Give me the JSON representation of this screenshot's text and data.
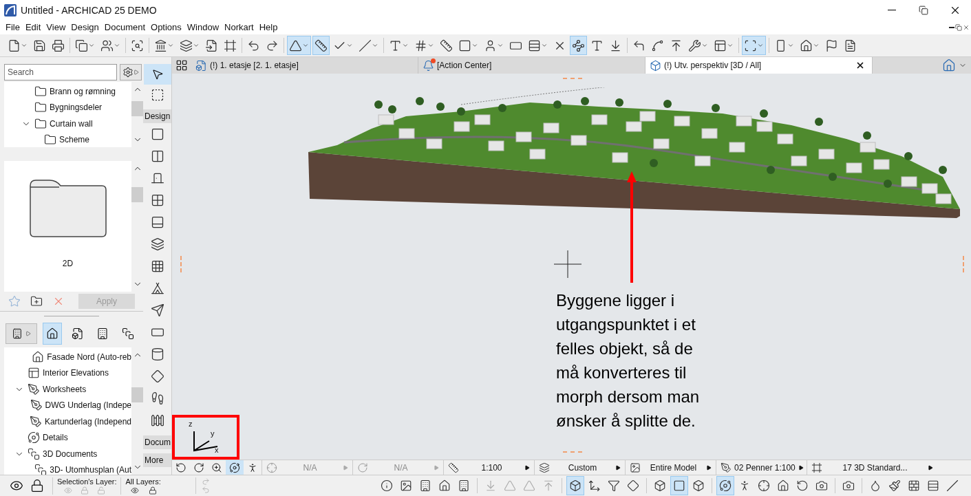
{
  "window": {
    "title": "Untitled - ARCHICAD 25 DEMO"
  },
  "menu": [
    "File",
    "Edit",
    "View",
    "Design",
    "Document",
    "Options",
    "Window",
    "Norkart",
    "Help"
  ],
  "toolbar": {
    "buttons": [
      {
        "pressed": false
      },
      {
        "pressed": false
      },
      {
        "pressed": false
      },
      {
        "pressed": false
      },
      {
        "pressed": false
      },
      {
        "pressed": false
      },
      {
        "pressed": false
      },
      {
        "pressed": false
      },
      {
        "pressed": false
      },
      {
        "pressed": false
      },
      {
        "pressed": false
      },
      {
        "pressed": false
      },
      {
        "pressed": true
      },
      {
        "pressed": true
      },
      {
        "pressed": false
      },
      {
        "pressed": false
      },
      {
        "pressed": false
      },
      {
        "pressed": false
      },
      {
        "pressed": false
      },
      {
        "pressed": false
      },
      {
        "pressed": false
      },
      {
        "pressed": false
      },
      {
        "pressed": false
      },
      {
        "pressed": false
      },
      {
        "pressed": true
      },
      {
        "pressed": false
      },
      {
        "pressed": false
      },
      {
        "pressed": false
      },
      {
        "pressed": false
      },
      {
        "pressed": false
      },
      {
        "pressed": false
      },
      {
        "pressed": false
      },
      {
        "pressed": true
      },
      {
        "pressed": false
      },
      {
        "pressed": false
      },
      {
        "pressed": false
      },
      {
        "pressed": false
      }
    ]
  },
  "navigator": {
    "search": {
      "placeholder": "Search"
    },
    "items": [
      {
        "label": "Brann og rømning",
        "kind": "folder"
      },
      {
        "label": "Bygningsdeler",
        "kind": "folder"
      },
      {
        "label": "Curtain wall",
        "kind": "folder",
        "expanded": true,
        "children": [
          {
            "label": "Scheme",
            "kind": "folder"
          }
        ]
      }
    ],
    "preview": {
      "label": "2D"
    },
    "apply_button": {
      "label": "Apply",
      "disabled": true
    },
    "map_views": [
      {
        "selected": true
      },
      {
        "selected": false
      },
      {
        "selected": false
      },
      {
        "selected": false
      }
    ],
    "tree": [
      {
        "kind": "group",
        "children": [
          {
            "label": "Fasade Nord (Auto-reb",
            "kind": "elevation"
          }
        ]
      },
      {
        "label": "Interior Elevations",
        "kind": "interior-elevation"
      },
      {
        "label": "Worksheets",
        "kind": "worksheet",
        "expanded": true,
        "children": [
          {
            "label": "DWG Underlag (Indepe",
            "kind": "worksheet"
          },
          {
            "label": "Kartunderlag (Independ",
            "kind": "worksheet"
          }
        ]
      },
      {
        "label": "Details",
        "kind": "detail"
      },
      {
        "label": "3D Documents",
        "kind": "document-3d",
        "expanded": true,
        "children": [
          {
            "label": "3D- Utomhusplan (Aut",
            "kind": "document-3d"
          }
        ]
      }
    ]
  },
  "toolbox": {
    "top_tools": [
      {
        "selected": true
      },
      {
        "selected": false
      }
    ],
    "sections": [
      {
        "label": "Design",
        "tools": [
          {
            "selected": false
          },
          {
            "selected": false
          },
          {
            "selected": false
          },
          {
            "selected": false
          },
          {
            "selected": false
          },
          {
            "selected": false
          },
          {
            "selected": false
          },
          {
            "selected": false
          },
          {
            "selected": false
          },
          {
            "selected": false
          },
          {
            "selected": false
          },
          {
            "selected": false
          },
          {
            "selected": false
          },
          {
            "selected": false
          }
        ]
      },
      {
        "label": "Docum"
      },
      {
        "label": "More"
      }
    ]
  },
  "tabs": [
    {
      "label": "(!) 1. etasje [2. 1. etasje]",
      "kind": "floor-plan",
      "selected": false,
      "notification": false
    },
    {
      "label": "[Action Center]",
      "kind": "action-center",
      "selected": false,
      "notification": true
    },
    {
      "label": "(!) Utv. perspektiv [3D / All]",
      "kind": "view-3d",
      "selected": true,
      "notification": false
    }
  ],
  "canvas": {
    "annotation": [
      "Byggene ligger i",
      "utgangspunktet i et",
      "felles objekt, så de",
      "må konverteres til",
      "morph dersom man",
      "ønsker å splitte de."
    ],
    "axes": {
      "z": "z",
      "y": "y",
      "x": "x"
    }
  },
  "status_bar": {
    "view_buttons": [
      {
        "pressed": false
      },
      {
        "pressed": false
      },
      {
        "pressed": false
      },
      {
        "pressed": true
      },
      {
        "pressed": false
      }
    ],
    "fields": [
      {
        "kind": "zoom",
        "value": "N/A",
        "disabled": true
      },
      {
        "kind": "rotation",
        "value": "N/A",
        "disabled": true
      },
      {
        "kind": "scale",
        "value": "1:100",
        "disabled": false
      },
      {
        "kind": "layers",
        "value": "Custom",
        "disabled": false
      },
      {
        "kind": "model",
        "value": "Entire Model",
        "disabled": false
      },
      {
        "kind": "pen",
        "value": "02 Penner 1:100",
        "disabled": false
      },
      {
        "kind": "style",
        "value": "17 3D Standard...",
        "disabled": false
      }
    ]
  },
  "bottom_bar": {
    "selection_layer_label": "Selection's Layer:",
    "all_layers_label": "All Layers:",
    "buttons": [
      {
        "pressed": false
      },
      {
        "pressed": false
      },
      {
        "pressed": false
      },
      {
        "pressed": false
      },
      {
        "pressed": false
      },
      {
        "pressed": false
      },
      {
        "pressed": false
      },
      {
        "pressed": false
      },
      {
        "pressed": false
      },
      {
        "pressed": true
      },
      {
        "pressed": false
      },
      {
        "pressed": false
      },
      {
        "pressed": false
      },
      {
        "pressed": false
      },
      {
        "pressed": true
      },
      {
        "pressed": false
      },
      {
        "pressed": true
      },
      {
        "pressed": false
      },
      {
        "pressed": false
      },
      {
        "pressed": false
      },
      {
        "pressed": false
      },
      {
        "pressed": false
      },
      {
        "pressed": false
      },
      {
        "pressed": false
      },
      {
        "pressed": false
      },
      {
        "pressed": false
      },
      {
        "pressed": false
      },
      {
        "pressed": false
      }
    ]
  }
}
